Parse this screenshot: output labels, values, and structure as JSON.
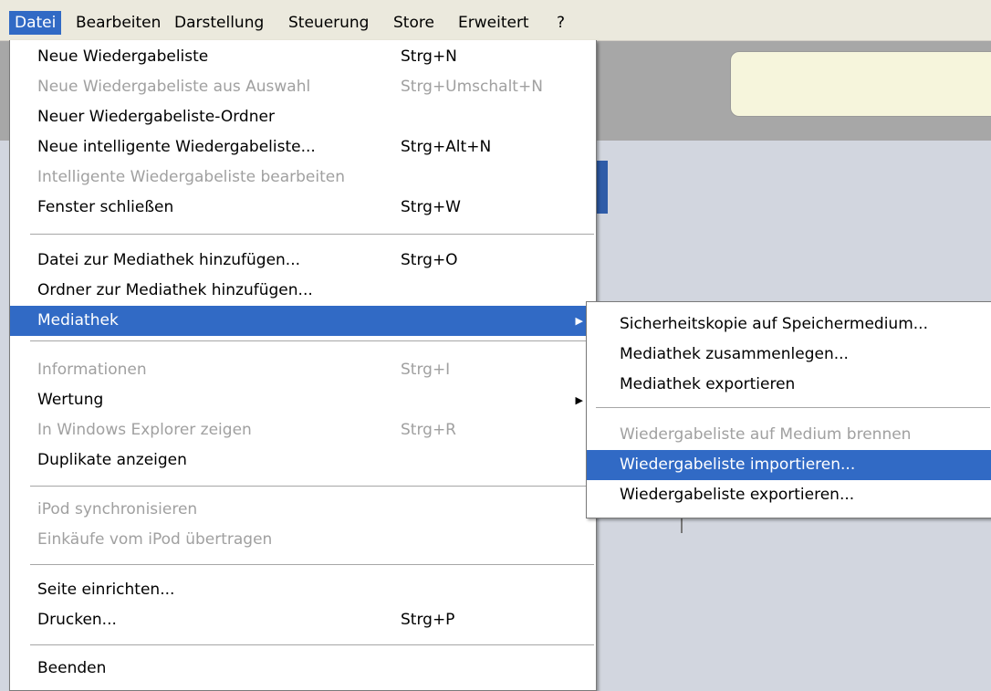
{
  "menubar": [
    "Datei",
    "Bearbeiten",
    "Darstellung",
    "Steuerung",
    "Store",
    "Erweitert",
    "?"
  ],
  "file_menu": {
    "items": [
      {
        "label": "Neue Wiedergabeliste",
        "shortcut": "Strg+N"
      },
      {
        "label": "Neue Wiedergabeliste aus Auswahl",
        "shortcut": "Strg+Umschalt+N",
        "disabled": true
      },
      {
        "label": "Neuer Wiedergabeliste-Ordner",
        "shortcut": ""
      },
      {
        "label": "Neue intelligente Wiedergabeliste...",
        "shortcut": "Strg+Alt+N"
      },
      {
        "label": "Intelligente Wiedergabeliste bearbeiten",
        "shortcut": "",
        "disabled": true
      },
      {
        "label": "Fenster schließen",
        "shortcut": "Strg+W"
      },
      {
        "label": "Datei zur Mediathek hinzufügen...",
        "shortcut": "Strg+O"
      },
      {
        "label": "Ordner zur Mediathek hinzufügen...",
        "shortcut": ""
      },
      {
        "label": "Mediathek",
        "shortcut": "",
        "submenu": true,
        "highlighted": true
      },
      {
        "label": "Informationen",
        "shortcut": "Strg+I",
        "disabled": true
      },
      {
        "label": "Wertung",
        "shortcut": "",
        "submenu": true
      },
      {
        "label": "In Windows Explorer zeigen",
        "shortcut": "Strg+R",
        "disabled": true
      },
      {
        "label": "Duplikate anzeigen",
        "shortcut": ""
      },
      {
        "label": "iPod synchronisieren",
        "shortcut": "",
        "disabled": true
      },
      {
        "label": "Einkäufe vom iPod übertragen",
        "shortcut": "",
        "disabled": true
      },
      {
        "label": "Seite einrichten...",
        "shortcut": ""
      },
      {
        "label": "Drucken...",
        "shortcut": "Strg+P"
      },
      {
        "label": "Beenden",
        "shortcut": ""
      }
    ]
  },
  "mediathek_submenu": {
    "items": [
      {
        "label": "Sicherheitskopie auf Speichermedium..."
      },
      {
        "label": "Mediathek zusammenlegen..."
      },
      {
        "label": "Mediathek exportieren"
      },
      {
        "label": "Wiedergabeliste auf Medium brennen",
        "disabled": true
      },
      {
        "label": "Wiedergabeliste importieren...",
        "highlighted": true
      },
      {
        "label": "Wiedergabeliste exportieren..."
      }
    ]
  },
  "icons": {
    "submenu_arrow": "▶"
  },
  "colors": {
    "highlight": "#316ac5",
    "disabled_text": "#a0a0a0",
    "menubar_bg": "#ebe9dd"
  }
}
